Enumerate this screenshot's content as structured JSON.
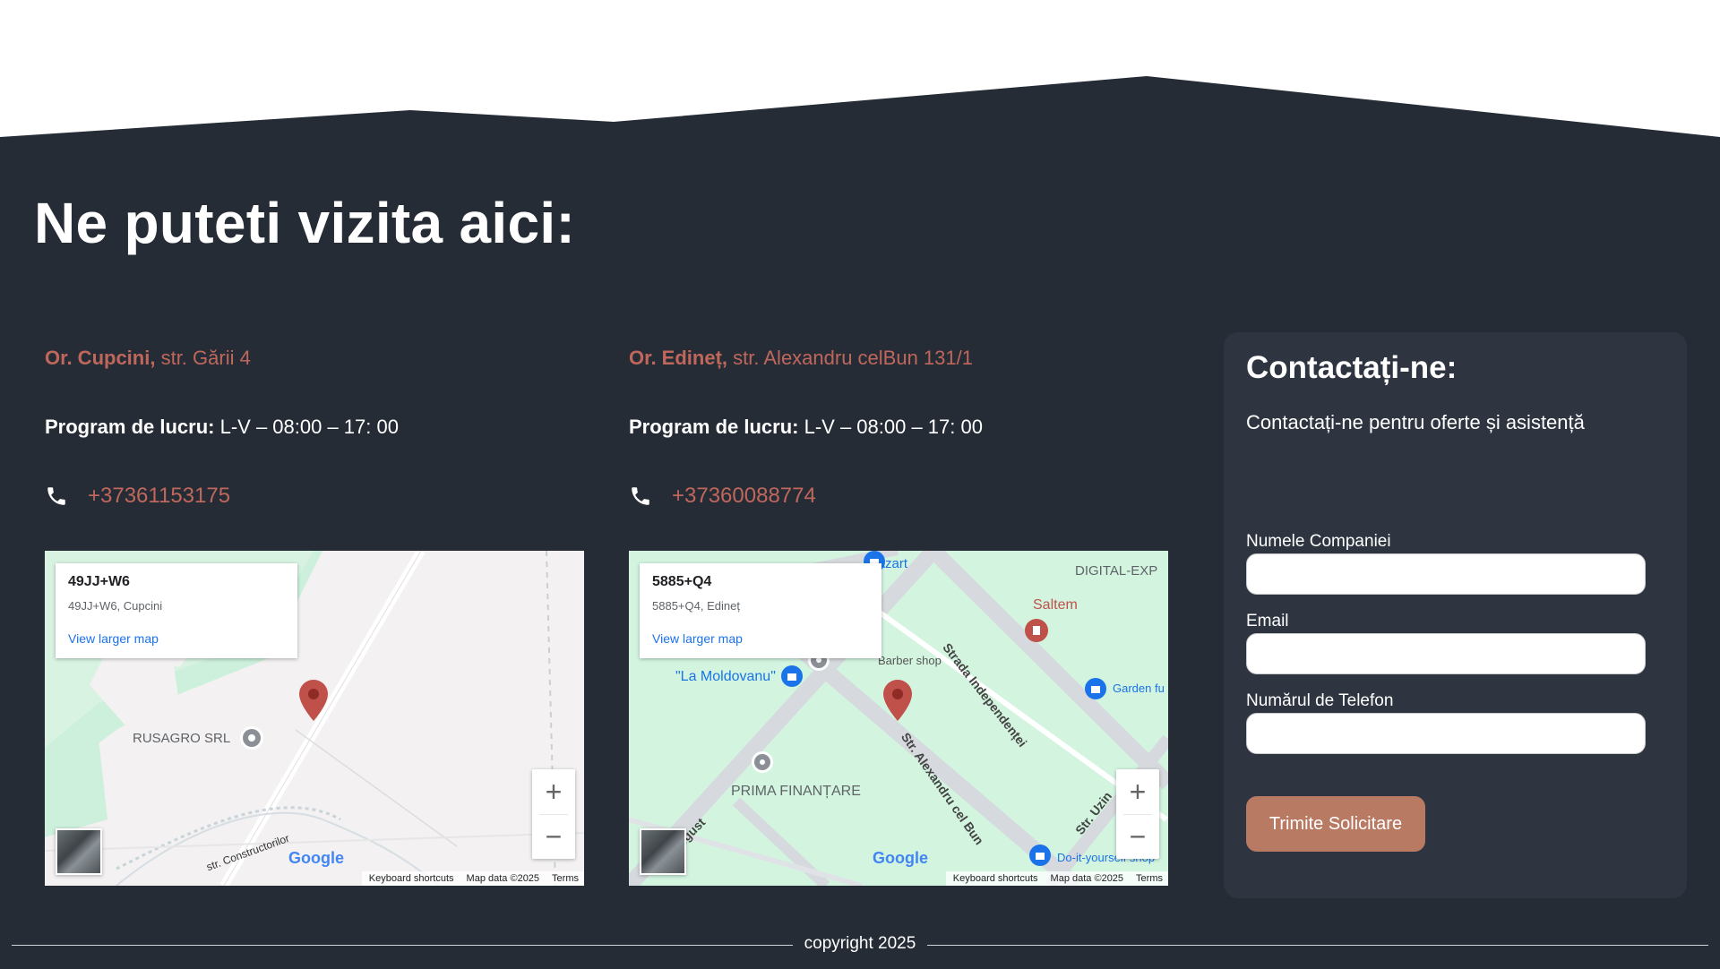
{
  "section_title": "Ne puteti vizita aici:",
  "locations": [
    {
      "city": "Or. Cupcini,",
      "street": " str. Gării 4",
      "hours_label": "Program de lucru:",
      "hours_value": " L-V – 08:00 – 17: 00",
      "phone": "+37361153175",
      "map": {
        "code": "49JJ+W6",
        "sub": "49JJ+W6, Cupcini",
        "larger_map": "View larger map",
        "labels": [
          "RUSAGRO SRL",
          "str. Constructorilor"
        ],
        "google": "Google",
        "attribution": [
          "Keyboard shortcuts",
          "Map data ©2025",
          "Terms"
        ]
      }
    },
    {
      "city": "Or. Edineț,",
      "street": " str. Alexandru celBun 131/1",
      "hours_label": "Program de lucru:",
      "hours_value": " L-V – 08:00 – 17: 00",
      "phone": "+37360088774",
      "map": {
        "code": "5885+Q4",
        "sub": "5885+Q4, Edineț",
        "larger_map": "View larger map",
        "labels": [
          "Azart",
          "DIGITAL-EXP",
          "Saltem",
          "Barber shop",
          "\"La Moldovanu\"",
          "Garden fu",
          "PRIMA FINANȚARE",
          "Strada Independenței",
          "Str. Alexandru cel Bun",
          "Str. Uzin",
          "Do-it-yourself shop",
          "ugust"
        ],
        "google": "Google",
        "attribution": [
          "Keyboard shortcuts",
          "Map data ©2025",
          "Terms"
        ]
      }
    }
  ],
  "contact": {
    "title": "Contactați-ne:",
    "subtitle": "Contactați-ne pentru oferte și asistență",
    "fields": [
      {
        "label": "Numele Companiei",
        "value": ""
      },
      {
        "label": "Email",
        "value": ""
      },
      {
        "label": "Numărul de Telefon",
        "value": ""
      }
    ],
    "submit": "Trimite Solicitare"
  },
  "footer": {
    "copyright": "copyright 2025"
  },
  "colors": {
    "background": "#252c36",
    "panel": "#2e3540",
    "accent": "#c0675c",
    "button": "#b97a63"
  },
  "icons": [
    "phone-icon",
    "map-pin-icon",
    "zoom-in-icon",
    "zoom-out-icon",
    "satellite-icon"
  ]
}
